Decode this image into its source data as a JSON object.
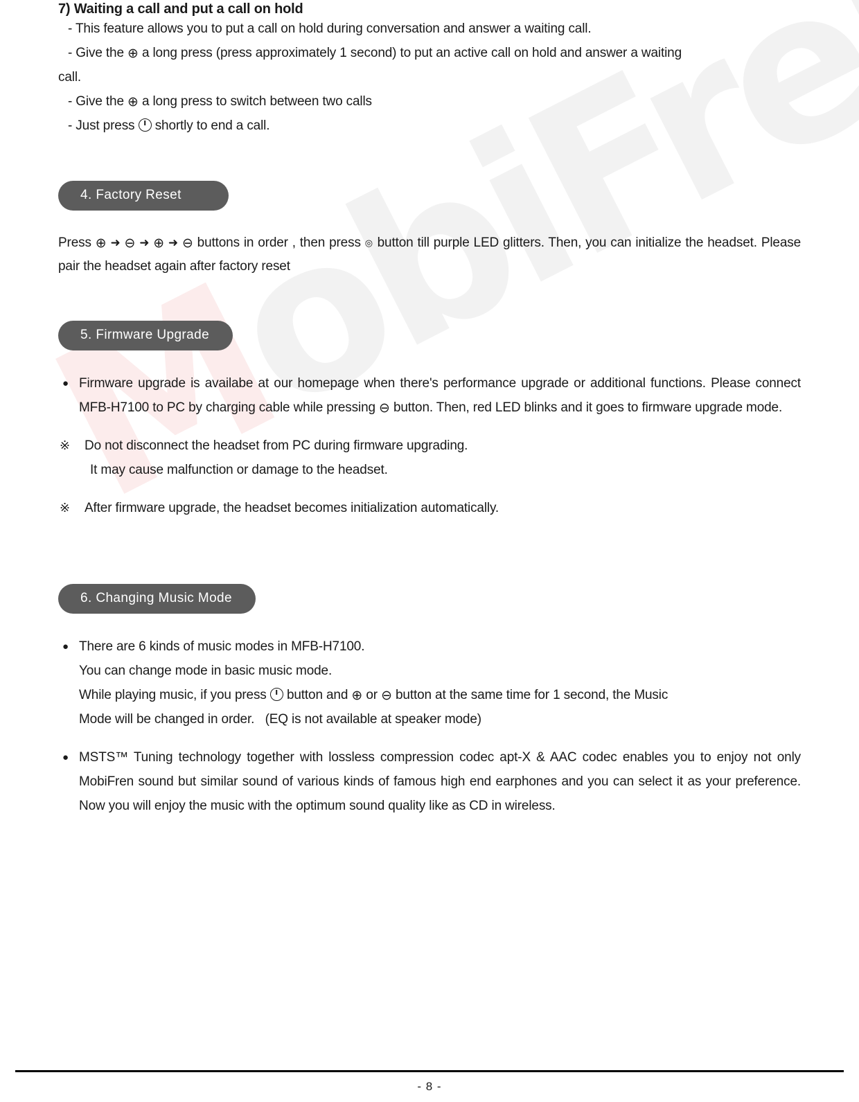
{
  "document": {
    "page_number_label": "- 8 -",
    "watermark_text": "MobiFren",
    "watermark_initial": "M",
    "watermark_rest": "obiFren",
    "pill_color": "#5c5c5c",
    "pill_text_color": "#ffffff"
  },
  "section7": {
    "title": "7) Waiting a call and put a call on hold",
    "line1": "- This feature allows you to put a call on hold during conversation and answer a waiting call.",
    "line2_pre": "- Give the",
    "line2_glyph": "⊕",
    "line2_post": "a long press (press approximately 1 second) to put an active call on hold and answer a waiting",
    "line2_wrap": "call.",
    "line3_pre": "- Give the",
    "line3_glyph": "⊕",
    "line3_post": "a long press to switch between two calls",
    "line4_pre": "- Just press",
    "line4_glyph": "power-button",
    "line4_post": "shortly to end a call."
  },
  "section4": {
    "pill_label": "4. Factory Reset",
    "text_pre": "Press",
    "seq": [
      {
        "glyph": "⊕",
        "name": "plus-circle"
      },
      {
        "arrow": "➜"
      },
      {
        "glyph": "⊖",
        "name": "minus-circle"
      },
      {
        "arrow": "➜"
      },
      {
        "glyph": "⊕",
        "name": "plus-circle"
      },
      {
        "arrow": "➜"
      },
      {
        "glyph": "⊖",
        "name": "minus-circle"
      }
    ],
    "text_mid": "buttons in order , then press",
    "mfb_glyph": "◎",
    "text_post": "button till purple LED glitters. Then, you can initialize the headset. Please pair the headset again after factory reset"
  },
  "section5": {
    "pill_label": "5. Firmware Upgrade",
    "bullet1_part1": "Firmware upgrade is availabe at our homepage when there's performance upgrade or additional functions. Please connect MFB-H7100 to PC by charging cable while pressing",
    "bullet1_glyph": "⊖",
    "bullet1_part2": "button. Then, red LED blinks and it goes to firmware upgrade mode.",
    "note1_mark": "※",
    "note1_line1": "Do not disconnect the headset from PC during firmware upgrading.",
    "note1_line2": "It may cause malfunction or damage to the headset.",
    "note2_mark": "※",
    "note2_line1": "After firmware upgrade, the headset becomes initialization automatically."
  },
  "section6": {
    "pill_label": "6. Changing Music Mode",
    "bullet1_line1": "There are 6 kinds of music modes in MFB-H7100.",
    "bullet1_line2": "You can change mode in basic music mode.",
    "bullet1_line3_pre": "While playing music, if you press",
    "bullet1_line3_glyph_power": "power-button",
    "bullet1_line3_mid1": "button and",
    "bullet1_line3_glyph_plus": "⊕",
    "bullet1_line3_mid2": "or",
    "bullet1_line3_glyph_minus": "⊖",
    "bullet1_line3_post": "button at the same time for 1 second, the Music",
    "bullet1_line4": "Mode will be changed in order.   (EQ is not available at speaker mode)",
    "bullet2_text": "MSTS™ Tuning technology together with lossless compression codec apt-X & AAC codec enables you to enjoy not only MobiFren sound but similar sound of various kinds of famous high end earphones and you can select it as your preference. Now you will enjoy the music with the optimum sound quality like as CD in wireless.",
    "bullet_dot": "●"
  }
}
